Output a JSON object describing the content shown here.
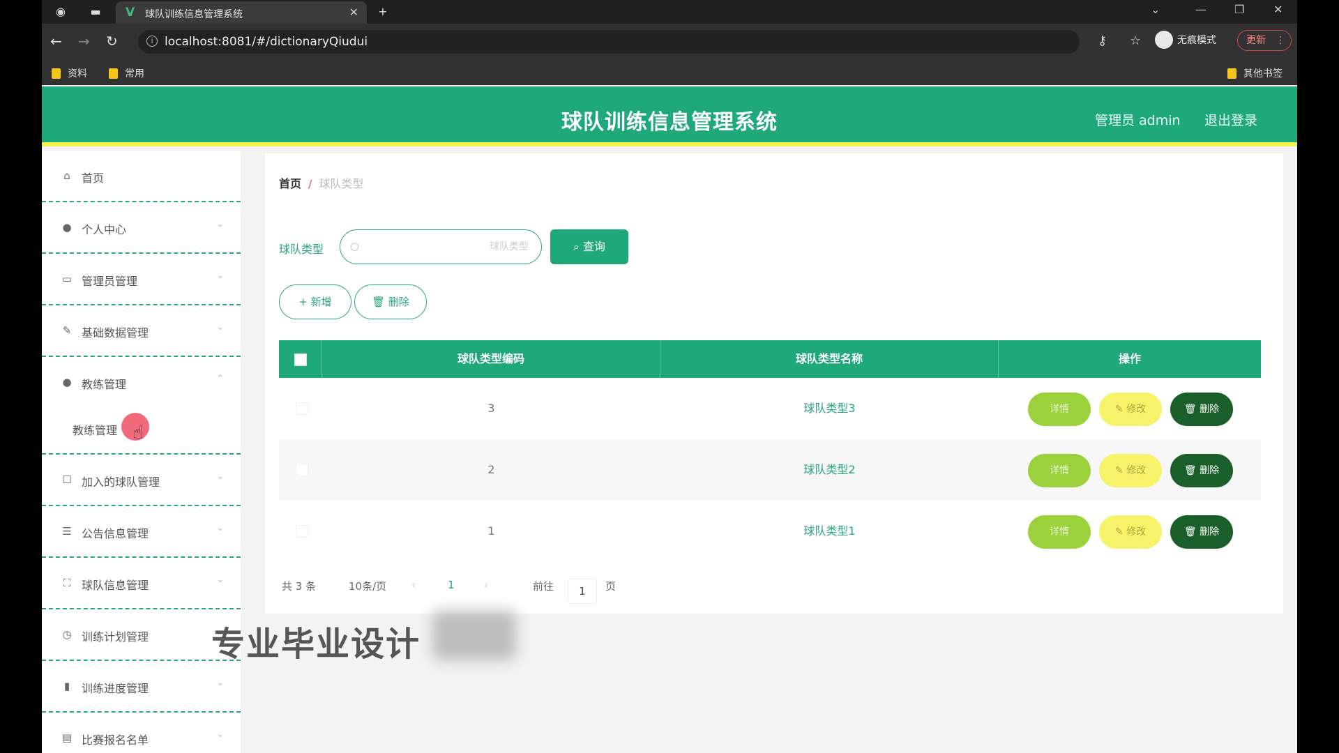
{
  "browser": {
    "tab_title": "球队训练信息管理系统",
    "url": "localhost:8081/#/dictionaryQiudui",
    "incognito_label": "无痕模式",
    "update_label": "更新",
    "bookmarks": [
      "资料",
      "常用"
    ],
    "other_bookmarks": "其他书签"
  },
  "header": {
    "title": "球队训练信息管理系统",
    "admin": "管理员 admin",
    "logout": "退出登录"
  },
  "sidebar": {
    "items": [
      {
        "label": "首页",
        "icon": "home-icon"
      },
      {
        "label": "个人中心",
        "icon": "user-icon"
      },
      {
        "label": "管理员管理",
        "icon": "briefcase-icon"
      },
      {
        "label": "基础数据管理",
        "icon": "edit-icon"
      },
      {
        "label": "教练管理",
        "icon": "user-icon"
      },
      {
        "label": "加入的球队管理",
        "icon": "square-icon"
      },
      {
        "label": "公告信息管理",
        "icon": "list-icon"
      },
      {
        "label": "球队信息管理",
        "icon": "frame-icon"
      },
      {
        "label": "训练计划管理",
        "icon": "clock-icon"
      },
      {
        "label": "训练进度管理",
        "icon": "bar-chart-icon"
      },
      {
        "label": "比赛报名名单",
        "icon": "clipboard-icon"
      }
    ],
    "sub_item": "教练管理"
  },
  "breadcrumb": {
    "home": "首页",
    "separator": "/",
    "current": "球队类型"
  },
  "search": {
    "label": "球队类型",
    "placeholder": "球队类型",
    "value": "",
    "button": "查询"
  },
  "actions": {
    "add": "新增",
    "delete": "删除"
  },
  "table": {
    "headers": [
      "球队类型编码",
      "球队类型名称",
      "操作"
    ],
    "rows": [
      {
        "code": "3",
        "name": "球队类型3"
      },
      {
        "code": "2",
        "name": "球队类型2"
      },
      {
        "code": "1",
        "name": "球队类型1"
      }
    ],
    "row_actions": {
      "detail": "详情",
      "edit": "修改",
      "delete": "删除"
    }
  },
  "pagination": {
    "total": "共 3 条",
    "page_size": "10条/页",
    "current_page": "1",
    "goto_label": "前往",
    "goto_value": "1",
    "page_suffix": "页"
  },
  "watermark": "专业毕业设计",
  "colors": {
    "primary": "#1fa87a",
    "accent_bar": "#f6f04a",
    "detail": "#9bd13a",
    "edit": "#f6f36a",
    "delete": "#1a5f2a"
  }
}
